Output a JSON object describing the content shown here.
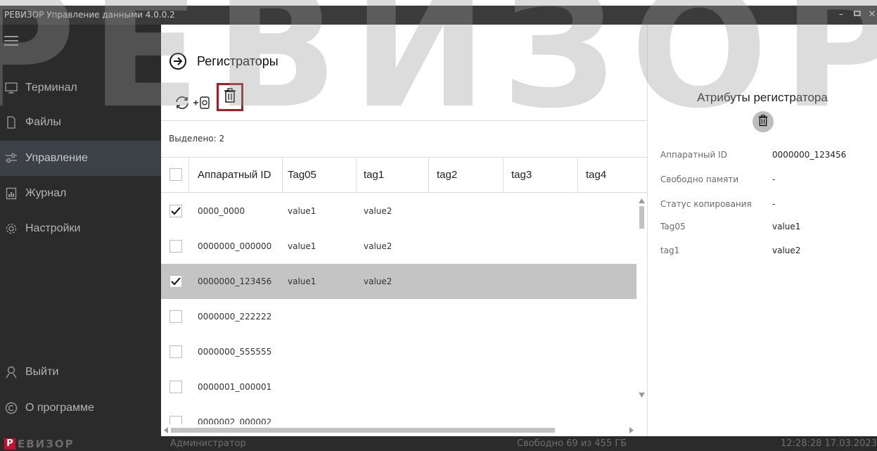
{
  "window": {
    "title": "РЕВИЗОР Управление данными 4.0.0.2"
  },
  "sidebar": {
    "items": [
      {
        "label": "Терминал",
        "icon": "terminal-icon"
      },
      {
        "label": "Файлы",
        "icon": "files-icon"
      },
      {
        "label": "Управление",
        "icon": "sliders-icon",
        "active": true
      },
      {
        "label": "Журнал",
        "icon": "journal-icon"
      },
      {
        "label": "Настройки",
        "icon": "gear-icon"
      }
    ],
    "bottom": [
      {
        "label": "Выйти",
        "icon": "user-icon"
      },
      {
        "label": "О программе",
        "icon": "copyright-icon"
      }
    ]
  },
  "main": {
    "title": "Регистраторы",
    "selected_label": "Выделено: 2",
    "columns": [
      "Аппаратный ID",
      "Tag05",
      "tag1",
      "tag2",
      "tag3",
      "tag4"
    ],
    "rows": [
      {
        "checked": true,
        "selected": false,
        "id": "0000_0000",
        "tag05": "value1",
        "tag1": "value2"
      },
      {
        "checked": false,
        "selected": false,
        "id": "0000000_000000",
        "tag05": "value1",
        "tag1": "value2"
      },
      {
        "checked": true,
        "selected": true,
        "id": "0000000_123456",
        "tag05": "value1",
        "tag1": "value2"
      },
      {
        "checked": false,
        "selected": false,
        "id": "0000000_222222",
        "tag05": "",
        "tag1": ""
      },
      {
        "checked": false,
        "selected": false,
        "id": "0000000_555555",
        "tag05": "",
        "tag1": ""
      },
      {
        "checked": false,
        "selected": false,
        "id": "0000001_000001",
        "tag05": "",
        "tag1": ""
      },
      {
        "checked": false,
        "selected": false,
        "id": "0000002_000002",
        "tag05": "",
        "tag1": ""
      }
    ]
  },
  "attributes": {
    "title": "Атрибуты регистратора",
    "items": [
      {
        "key": "Аппаратный ID",
        "value": "0000000_123456"
      },
      {
        "key": "Свободно памяти",
        "value": "-"
      },
      {
        "key": "Статус копирования",
        "value": "-"
      },
      {
        "key": "Tag05",
        "value": "value1"
      },
      {
        "key": "tag1",
        "value": "value2"
      }
    ]
  },
  "statusbar": {
    "brand_first": "Р",
    "brand_rest": "ЕВИЗОР",
    "user": "Администратор",
    "free_space": "Свободно 69 из 455 ГБ",
    "datetime": "12:28:28 17.03.2023"
  },
  "watermark": {
    "text": "РЕВИЗОР"
  },
  "colors": {
    "sidebar_bg": "#2b2b2b",
    "titlebar_bg": "#3b3b3b",
    "active_item_bg": "#3c4047",
    "selected_row_bg": "#c4c4c4",
    "highlight_border": "#a41e26",
    "brand_red": "#c8102e"
  }
}
